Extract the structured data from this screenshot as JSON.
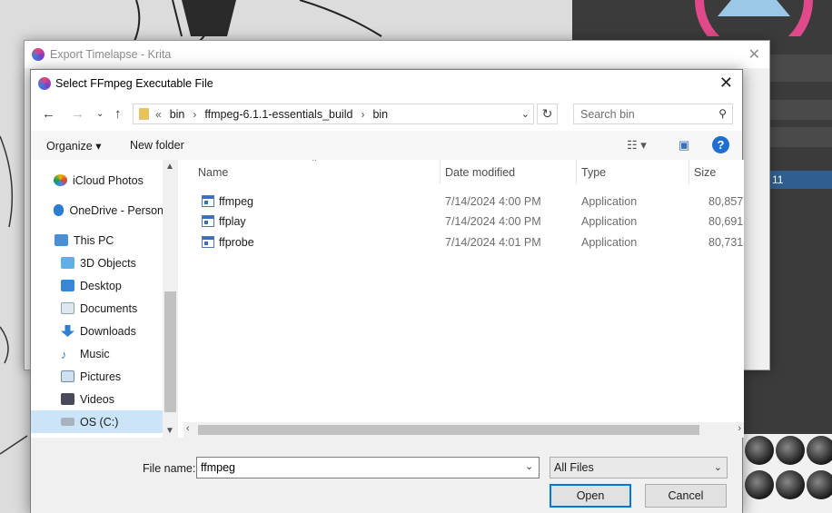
{
  "background": {
    "export_window_title": "Export Timelapse - Krita",
    "panel_label": "11"
  },
  "dialog": {
    "title": "Select FFmpeg Executable File",
    "breadcrumbs": [
      "«",
      "bin",
      "ffmpeg-6.1.1-essentials_build",
      "bin"
    ],
    "search_placeholder": "Search bin",
    "toolbar": {
      "organize_label": "Organize",
      "new_folder_label": "New folder"
    },
    "nav_items": [
      {
        "label": "iCloud Photos",
        "icon": "icloud-photos-icon"
      },
      {
        "label": "OneDrive - Person",
        "icon": "onedrive-icon"
      },
      {
        "label": "This PC",
        "icon": "this-pc-icon"
      },
      {
        "label": "3D Objects",
        "icon": "3d-objects-icon"
      },
      {
        "label": "Desktop",
        "icon": "desktop-icon"
      },
      {
        "label": "Documents",
        "icon": "documents-icon"
      },
      {
        "label": "Downloads",
        "icon": "downloads-icon"
      },
      {
        "label": "Music",
        "icon": "music-icon"
      },
      {
        "label": "Pictures",
        "icon": "pictures-icon"
      },
      {
        "label": "Videos",
        "icon": "videos-icon"
      },
      {
        "label": "OS (C:)",
        "icon": "drive-icon"
      }
    ],
    "columns": [
      "Name",
      "Date modified",
      "Type",
      "Size"
    ],
    "files": [
      {
        "name": "ffmpeg",
        "date": "7/14/2024 4:00 PM",
        "type": "Application",
        "size": "80,857"
      },
      {
        "name": "ffplay",
        "date": "7/14/2024 4:00 PM",
        "type": "Application",
        "size": "80,691"
      },
      {
        "name": "ffprobe",
        "date": "7/14/2024 4:01 PM",
        "type": "Application",
        "size": "80,731"
      }
    ],
    "file_name_label": "File name:",
    "file_name_value": "ffmpeg",
    "file_type": "All Files",
    "open_label": "Open",
    "cancel_label": "Cancel",
    "selected_nav": "OS (C:)"
  }
}
